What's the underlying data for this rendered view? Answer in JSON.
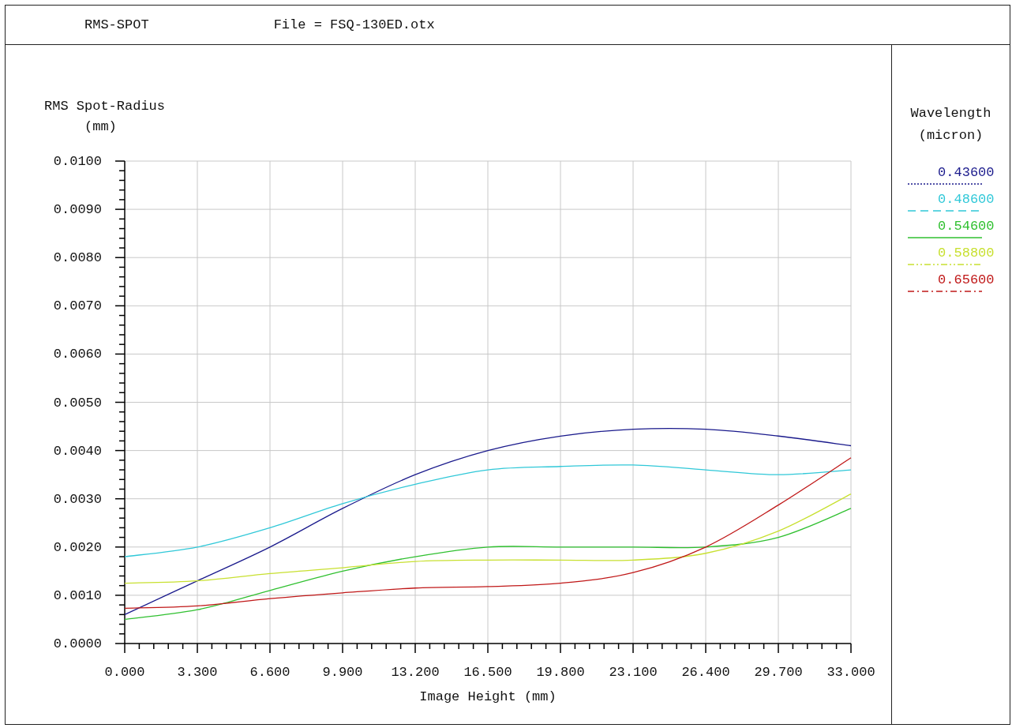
{
  "header": {
    "title": "RMS-SPOT",
    "file": "File = FSQ-130ED.otx"
  },
  "plot": {
    "y_unit": "(mm)",
    "chart_data": {
      "type": "line",
      "ylabel": "RMS Spot-Radius",
      "xlabel": "Image Height (mm)",
      "x": [
        0,
        3.3,
        6.6,
        9.9,
        13.2,
        16.5,
        19.8,
        23.1,
        26.4,
        29.7,
        33
      ],
      "grid": true,
      "xlim": [
        0,
        33
      ],
      "ylim": [
        0,
        0.01
      ],
      "xticks": [
        {
          "value": 0,
          "label": "0.000"
        },
        {
          "value": 3.3,
          "label": "3.300"
        },
        {
          "value": 6.6,
          "label": "6.600"
        },
        {
          "value": 9.9,
          "label": "9.900"
        },
        {
          "value": 13.2,
          "label": "13.200"
        },
        {
          "value": 16.5,
          "label": "16.500"
        },
        {
          "value": 19.8,
          "label": "19.800"
        },
        {
          "value": 23.1,
          "label": "23.100"
        },
        {
          "value": 26.4,
          "label": "26.400"
        },
        {
          "value": 29.7,
          "label": "29.700"
        },
        {
          "value": 33,
          "label": "33.000"
        }
      ],
      "yticks": [
        {
          "value": 0,
          "label": "0.0000"
        },
        {
          "value": 0.001,
          "label": "0.0010"
        },
        {
          "value": 0.002,
          "label": "0.0020"
        },
        {
          "value": 0.003,
          "label": "0.0030"
        },
        {
          "value": 0.004,
          "label": "0.0040"
        },
        {
          "value": 0.005,
          "label": "0.0050"
        },
        {
          "value": 0.006,
          "label": "0.0060"
        },
        {
          "value": 0.007,
          "label": "0.0070"
        },
        {
          "value": 0.008,
          "label": "0.0080"
        },
        {
          "value": 0.009,
          "label": "0.0090"
        },
        {
          "value": 0.01,
          "label": "0.0100"
        }
      ],
      "series": [
        {
          "name": "0.43600",
          "color": "#1a1a8c",
          "values": [
            0.0006,
            0.0013,
            0.002,
            0.0028,
            0.0035,
            0.004,
            0.0043,
            0.00444,
            0.00444,
            0.0043,
            0.0041
          ]
        },
        {
          "name": "0.48600",
          "color": "#30c8d8",
          "values": [
            0.0018,
            0.002,
            0.0024,
            0.0029,
            0.0033,
            0.0036,
            0.00367,
            0.0037,
            0.0036,
            0.0035,
            0.0036
          ]
        },
        {
          "name": "0.54600",
          "color": "#30c030",
          "values": [
            0.0005,
            0.0007,
            0.0011,
            0.0015,
            0.0018,
            0.002,
            0.002,
            0.002,
            0.002,
            0.0022,
            0.0028
          ]
        },
        {
          "name": "0.58800",
          "color": "#c8e030",
          "values": [
            0.00125,
            0.0013,
            0.00145,
            0.00157,
            0.0017,
            0.00173,
            0.00173,
            0.00173,
            0.00187,
            0.00233,
            0.0031
          ]
        },
        {
          "name": "0.65600",
          "color": "#c01818",
          "values": [
            0.00073,
            0.00078,
            0.00093,
            0.00105,
            0.00115,
            0.00118,
            0.00125,
            0.00147,
            0.002,
            0.00287,
            0.00385
          ]
        }
      ]
    }
  },
  "legend": {
    "title": "Wavelength",
    "unit": "(micron)"
  }
}
